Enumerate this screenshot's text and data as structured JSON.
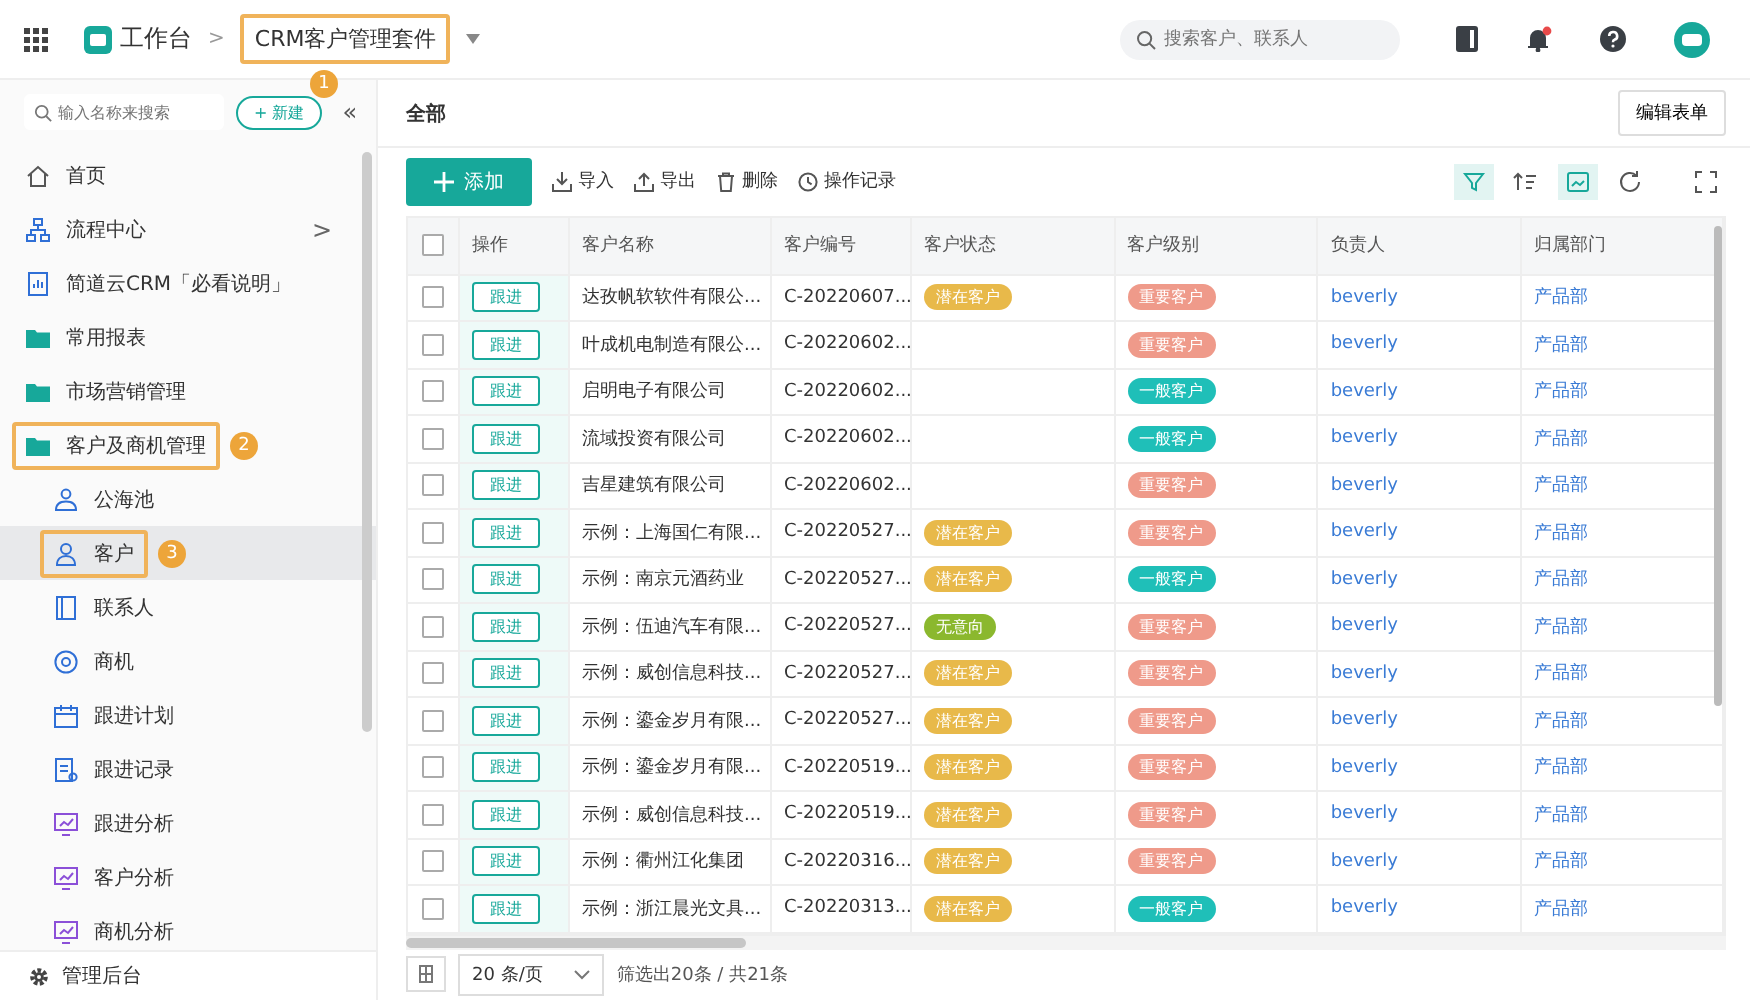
{
  "topbar": {
    "home": "工作台",
    "separator": ">",
    "app": {
      "title": "CRM客户管理套件",
      "annotated": true,
      "badge": "1"
    },
    "search": {
      "placeholder": "搜索客户、联系人"
    }
  },
  "sidebar": {
    "search": {
      "placeholder": "输入名称来搜索"
    },
    "new_button": "+ 新建",
    "collapse": "«",
    "items": [
      {
        "label": "首页",
        "kind": "home",
        "selected": false,
        "annotated": false
      },
      {
        "label": "流程中心",
        "kind": "flow",
        "selected": false,
        "annotated": false,
        "arrow": ">"
      },
      {
        "label": "简道云CRM「必看说明」",
        "kind": "doc",
        "selected": false,
        "annotated": false
      },
      {
        "label": "常用报表",
        "kind": "folder",
        "selected": false,
        "annotated": false
      },
      {
        "label": "市场营销管理",
        "kind": "folder",
        "selected": false,
        "annotated": false
      },
      {
        "label": "客户及商机管理",
        "kind": "folder",
        "selected": false,
        "annotated": true,
        "badge": "2",
        "children": [
          {
            "label": "公海池",
            "kind": "people",
            "selected": false,
            "annotated": false
          },
          {
            "label": "客户",
            "kind": "person",
            "selected": true,
            "annotated": true,
            "badge": "3"
          },
          {
            "label": "联系人",
            "kind": "book",
            "selected": false,
            "annotated": false
          },
          {
            "label": "商机",
            "kind": "target",
            "selected": false,
            "annotated": false
          },
          {
            "label": "跟进计划",
            "kind": "calendar",
            "selected": false,
            "annotated": false
          },
          {
            "label": "跟进记录",
            "kind": "record",
            "selected": false,
            "annotated": false
          },
          {
            "label": "跟进分析",
            "kind": "chart",
            "selected": false,
            "annotated": false
          },
          {
            "label": "客户分析",
            "kind": "chart",
            "selected": false,
            "annotated": false
          },
          {
            "label": "商机分析",
            "kind": "chart",
            "selected": false,
            "annotated": false
          }
        ]
      }
    ],
    "footer": "管理后台"
  },
  "view": {
    "title": "全部",
    "edit_button": "编辑表单"
  },
  "toolbar": {
    "add": "添加",
    "actions": [
      "导入",
      "导出",
      "删除",
      "操作记录"
    ]
  },
  "table": {
    "all_checked": false,
    "columns": [
      "操作",
      "客户名称",
      "客户编号",
      "客户状态",
      "客户级别",
      "负责人",
      "归属部门"
    ],
    "rows": [
      {
        "checked": false,
        "action": "跟进",
        "name": "达孜帆软软件有限公...",
        "code": "C-20220607...",
        "status": {
          "text": "潜在客户",
          "color": "#e8b94a"
        },
        "level": {
          "text": "重要客户",
          "color": "#ef9a8a"
        },
        "owner": "beverly",
        "dept": "产品部"
      },
      {
        "checked": false,
        "action": "跟进",
        "name": "叶成机电制造有限公...",
        "code": "C-20220602...",
        "level": {
          "text": "重要客户",
          "color": "#ef9a8a"
        },
        "owner": "beverly",
        "dept": "产品部"
      },
      {
        "checked": false,
        "action": "跟进",
        "name": "启明电子有限公司",
        "code": "C-20220602...",
        "level": {
          "text": "一般客户",
          "color": "#1fbfb8"
        },
        "owner": "beverly",
        "dept": "产品部"
      },
      {
        "checked": false,
        "action": "跟进",
        "name": "流域投资有限公司",
        "code": "C-20220602...",
        "level": {
          "text": "一般客户",
          "color": "#1fbfb8"
        },
        "owner": "beverly",
        "dept": "产品部"
      },
      {
        "checked": false,
        "action": "跟进",
        "name": "吉星建筑有限公司",
        "code": "C-20220602...",
        "level": {
          "text": "重要客户",
          "color": "#ef9a8a"
        },
        "owner": "beverly",
        "dept": "产品部"
      },
      {
        "checked": false,
        "action": "跟进",
        "name": "示例：上海国仁有限...",
        "code": "C-20220527...",
        "status": {
          "text": "潜在客户",
          "color": "#e8b94a"
        },
        "level": {
          "text": "重要客户",
          "color": "#ef9a8a"
        },
        "owner": "beverly",
        "dept": "产品部"
      },
      {
        "checked": false,
        "action": "跟进",
        "name": "示例：南京元酒药业",
        "code": "C-20220527...",
        "status": {
          "text": "潜在客户",
          "color": "#e8b94a"
        },
        "level": {
          "text": "一般客户",
          "color": "#1fbfb8"
        },
        "owner": "beverly",
        "dept": "产品部"
      },
      {
        "checked": false,
        "action": "跟进",
        "name": "示例：伍迪汽车有限...",
        "code": "C-20220527...",
        "status": {
          "text": "无意向",
          "color": "#8bb82e"
        },
        "level": {
          "text": "重要客户",
          "color": "#ef9a8a"
        },
        "owner": "beverly",
        "dept": "产品部"
      },
      {
        "checked": false,
        "action": "跟进",
        "name": "示例：威创信息科技...",
        "code": "C-20220527...",
        "status": {
          "text": "潜在客户",
          "color": "#e8b94a"
        },
        "level": {
          "text": "重要客户",
          "color": "#ef9a8a"
        },
        "owner": "beverly",
        "dept": "产品部"
      },
      {
        "checked": false,
        "action": "跟进",
        "name": "示例：鎏金岁月有限...",
        "code": "C-20220527...",
        "status": {
          "text": "潜在客户",
          "color": "#e8b94a"
        },
        "level": {
          "text": "重要客户",
          "color": "#ef9a8a"
        },
        "owner": "beverly",
        "dept": "产品部"
      },
      {
        "checked": false,
        "action": "跟进",
        "name": "示例：鎏金岁月有限...",
        "code": "C-20220519...",
        "status": {
          "text": "潜在客户",
          "color": "#e8b94a"
        },
        "level": {
          "text": "重要客户",
          "color": "#ef9a8a"
        },
        "owner": "beverly",
        "dept": "产品部"
      },
      {
        "checked": false,
        "action": "跟进",
        "name": "示例：威创信息科技...",
        "code": "C-20220519...",
        "status": {
          "text": "潜在客户",
          "color": "#e8b94a"
        },
        "level": {
          "text": "重要客户",
          "color": "#ef9a8a"
        },
        "owner": "beverly",
        "dept": "产品部"
      },
      {
        "checked": false,
        "action": "跟进",
        "name": "示例：衢州江化集团",
        "code": "C-20220316...",
        "status": {
          "text": "潜在客户",
          "color": "#e8b94a"
        },
        "level": {
          "text": "重要客户",
          "color": "#ef9a8a"
        },
        "owner": "beverly",
        "dept": "产品部"
      },
      {
        "checked": false,
        "action": "跟进",
        "name": "示例：浙江晨光文具...",
        "code": "C-20220313...",
        "status": {
          "text": "潜在客户",
          "color": "#e8b94a"
        },
        "level": {
          "text": "一般客户",
          "color": "#1fbfb8"
        },
        "owner": "beverly",
        "dept": "产品部"
      }
    ]
  },
  "pagination": {
    "page_size": "20 条/页",
    "summary": "筛选出20条 / 共21条"
  }
}
